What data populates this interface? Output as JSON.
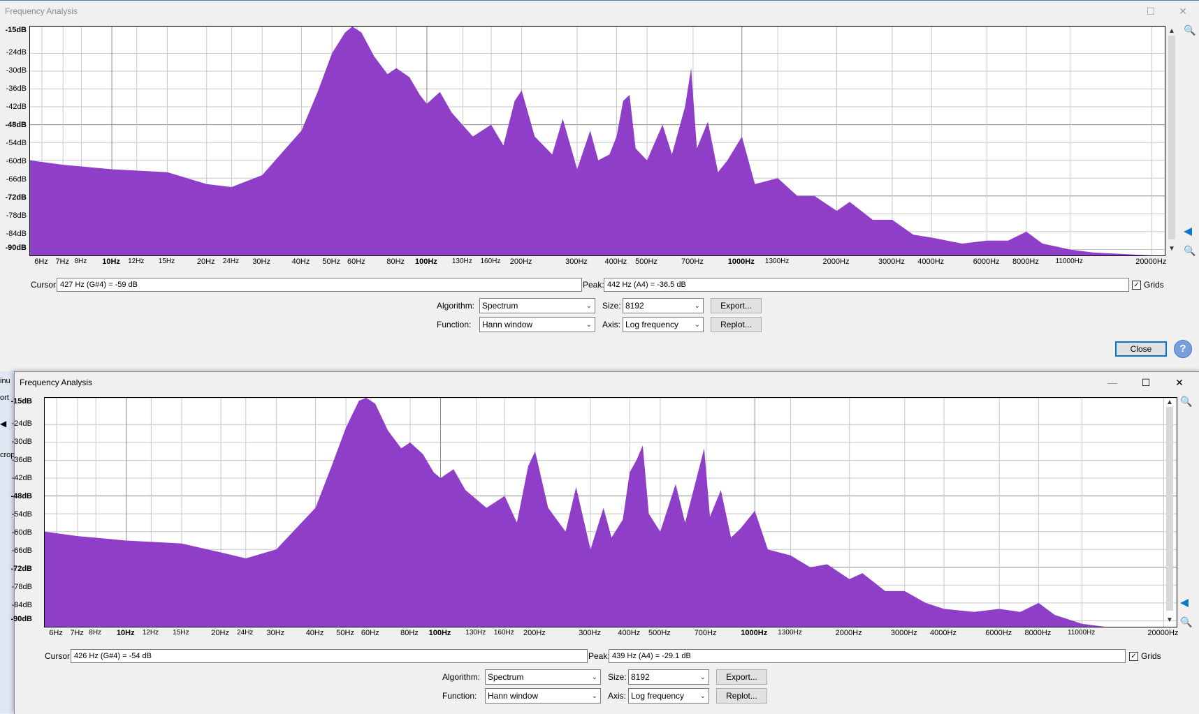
{
  "colors": {
    "spectrum_fill": "#8f3ec8",
    "accent": "#0078d7",
    "grid": "#c8c8c8"
  },
  "icons": {
    "maximize": "maximize-icon",
    "close": "close-icon",
    "minimize": "minimize-icon",
    "zoom_in": "zoom-in-icon",
    "zoom_out": "zoom-out-icon",
    "help": "help-icon"
  },
  "windows": [
    {
      "title": "Frequency Analysis",
      "y_labels": [
        "-15dB",
        "-24dB",
        "-30dB",
        "-36dB",
        "-42dB",
        "-48dB",
        "-54dB",
        "-60dB",
        "-66dB",
        "-72dB",
        "-78dB",
        "-84dB",
        "-90dB"
      ],
      "x_labels": [
        "6Hz",
        "7Hz",
        "8Hz",
        "10Hz",
        "12Hz",
        "15Hz",
        "20Hz",
        "24Hz",
        "30Hz",
        "40Hz",
        "50Hz",
        "60Hz",
        "80Hz",
        "100Hz",
        "130Hz",
        "160Hz",
        "200Hz",
        "300Hz",
        "400Hz",
        "500Hz",
        "700Hz",
        "1000Hz",
        "1300Hz",
        "2000Hz",
        "3000Hz",
        "4000Hz",
        "6000Hz",
        "8000Hz",
        "11000Hz",
        "20000Hz"
      ],
      "cursor_label": "Cursor:",
      "cursor_value": "427 Hz (G#4) = -59 dB",
      "peak_label": "Peak:",
      "peak_value": "442 Hz (A4) = -36.5 dB",
      "grids_label": "Grids",
      "algorithm_label": "Algorithm:",
      "algorithm_value": "Spectrum",
      "size_label": "Size:",
      "size_value": "8192",
      "export_label": "Export...",
      "function_label": "Function:",
      "function_value": "Hann window",
      "axis_label": "Axis:",
      "axis_value": "Log frequency",
      "replot_label": "Replot...",
      "close_label": "Close",
      "help_symbol": "?"
    },
    {
      "title": "Frequency Analysis",
      "y_labels": [
        "-15dB",
        "-24dB",
        "-30dB",
        "-36dB",
        "-42dB",
        "-48dB",
        "-54dB",
        "-60dB",
        "-66dB",
        "-72dB",
        "-78dB",
        "-84dB",
        "-90dB"
      ],
      "x_labels": [
        "6Hz",
        "7Hz",
        "8Hz",
        "10Hz",
        "12Hz",
        "15Hz",
        "20Hz",
        "24Hz",
        "30Hz",
        "40Hz",
        "50Hz",
        "60Hz",
        "80Hz",
        "100Hz",
        "130Hz",
        "160Hz",
        "200Hz",
        "300Hz",
        "400Hz",
        "500Hz",
        "700Hz",
        "1000Hz",
        "1300Hz",
        "2000Hz",
        "3000Hz",
        "4000Hz",
        "6000Hz",
        "8000Hz",
        "11000Hz",
        "20000Hz"
      ],
      "cursor_label": "Cursor:",
      "cursor_value": "426 Hz (G#4) = -54 dB",
      "peak_label": "Peak:",
      "peak_value": "439 Hz (A4) = -29.1 dB",
      "grids_label": "Grids",
      "algorithm_label": "Algorithm:",
      "algorithm_value": "Spectrum",
      "size_label": "Size:",
      "size_value": "8192",
      "export_label": "Export...",
      "function_label": "Function:",
      "function_value": "Hann window",
      "axis_label": "Axis:",
      "axis_value": "Log frequency",
      "replot_label": "Replot..."
    }
  ],
  "background_fragments": [
    "inu",
    "ort",
    "crop"
  ],
  "chart_data": [
    {
      "type": "area",
      "x_scale": "log",
      "xlim": [
        5.5,
        22000
      ],
      "ylim": [
        -92,
        -15
      ],
      "grid": true,
      "points": [
        [
          5.5,
          -60
        ],
        [
          7,
          -61.5
        ],
        [
          10,
          -63
        ],
        [
          15,
          -64
        ],
        [
          20,
          -68
        ],
        [
          24,
          -69
        ],
        [
          30,
          -65
        ],
        [
          40,
          -50
        ],
        [
          45,
          -37
        ],
        [
          50,
          -24
        ],
        [
          55,
          -17
        ],
        [
          58,
          -15
        ],
        [
          62,
          -17
        ],
        [
          68,
          -25
        ],
        [
          75,
          -31
        ],
        [
          80,
          -29
        ],
        [
          88,
          -32
        ],
        [
          95,
          -38
        ],
        [
          100,
          -41
        ],
        [
          110,
          -37
        ],
        [
          120,
          -44
        ],
        [
          140,
          -52
        ],
        [
          160,
          -48
        ],
        [
          175,
          -55
        ],
        [
          190,
          -40
        ],
        [
          200,
          -36.5
        ],
        [
          220,
          -52
        ],
        [
          250,
          -58
        ],
        [
          270,
          -46
        ],
        [
          300,
          -63
        ],
        [
          330,
          -50
        ],
        [
          350,
          -60
        ],
        [
          380,
          -58
        ],
        [
          400,
          -52
        ],
        [
          420,
          -40
        ],
        [
          440,
          -38
        ],
        [
          460,
          -56
        ],
        [
          500,
          -60
        ],
        [
          560,
          -48
        ],
        [
          600,
          -58
        ],
        [
          660,
          -42
        ],
        [
          690,
          -29
        ],
        [
          720,
          -56
        ],
        [
          780,
          -47
        ],
        [
          840,
          -64
        ],
        [
          900,
          -60
        ],
        [
          1000,
          -52
        ],
        [
          1100,
          -68
        ],
        [
          1300,
          -66
        ],
        [
          1500,
          -72
        ],
        [
          1700,
          -72
        ],
        [
          2000,
          -77
        ],
        [
          2200,
          -74
        ],
        [
          2600,
          -80
        ],
        [
          3000,
          -80
        ],
        [
          3500,
          -85
        ],
        [
          4000,
          -86
        ],
        [
          5000,
          -88
        ],
        [
          6000,
          -87
        ],
        [
          7000,
          -87
        ],
        [
          8000,
          -84
        ],
        [
          9000,
          -88
        ],
        [
          11000,
          -90
        ],
        [
          13000,
          -91
        ],
        [
          20000,
          -92
        ]
      ]
    },
    {
      "type": "area",
      "x_scale": "log",
      "xlim": [
        5.5,
        22000
      ],
      "ylim": [
        -92,
        -15
      ],
      "grid": true,
      "points": [
        [
          5.5,
          -60
        ],
        [
          7,
          -61.5
        ],
        [
          10,
          -63
        ],
        [
          15,
          -64
        ],
        [
          20,
          -67
        ],
        [
          24,
          -69
        ],
        [
          30,
          -66
        ],
        [
          40,
          -52
        ],
        [
          45,
          -38
        ],
        [
          50,
          -25
        ],
        [
          55,
          -16
        ],
        [
          58,
          -15
        ],
        [
          62,
          -17
        ],
        [
          68,
          -26
        ],
        [
          75,
          -32
        ],
        [
          80,
          -30
        ],
        [
          88,
          -34
        ],
        [
          95,
          -40
        ],
        [
          100,
          -42
        ],
        [
          110,
          -39
        ],
        [
          120,
          -46
        ],
        [
          140,
          -52
        ],
        [
          160,
          -48
        ],
        [
          175,
          -57
        ],
        [
          190,
          -38
        ],
        [
          200,
          -33
        ],
        [
          220,
          -52
        ],
        [
          250,
          -60
        ],
        [
          270,
          -45
        ],
        [
          300,
          -66
        ],
        [
          330,
          -52
        ],
        [
          350,
          -62
        ],
        [
          380,
          -56
        ],
        [
          400,
          -40
        ],
        [
          420,
          -36
        ],
        [
          440,
          -31
        ],
        [
          460,
          -54
        ],
        [
          500,
          -60
        ],
        [
          560,
          -44
        ],
        [
          600,
          -57
        ],
        [
          660,
          -40
        ],
        [
          690,
          -32
        ],
        [
          720,
          -55
        ],
        [
          780,
          -46
        ],
        [
          840,
          -62
        ],
        [
          900,
          -59
        ],
        [
          1000,
          -53
        ],
        [
          1100,
          -66
        ],
        [
          1300,
          -68
        ],
        [
          1500,
          -72
        ],
        [
          1700,
          -71
        ],
        [
          2000,
          -76
        ],
        [
          2200,
          -74
        ],
        [
          2600,
          -80
        ],
        [
          3000,
          -80
        ],
        [
          3500,
          -84
        ],
        [
          4000,
          -86
        ],
        [
          5000,
          -87
        ],
        [
          6000,
          -86
        ],
        [
          7000,
          -87
        ],
        [
          8000,
          -84
        ],
        [
          9000,
          -88
        ],
        [
          11000,
          -91
        ],
        [
          13000,
          -92
        ],
        [
          20000,
          -92
        ]
      ]
    }
  ]
}
